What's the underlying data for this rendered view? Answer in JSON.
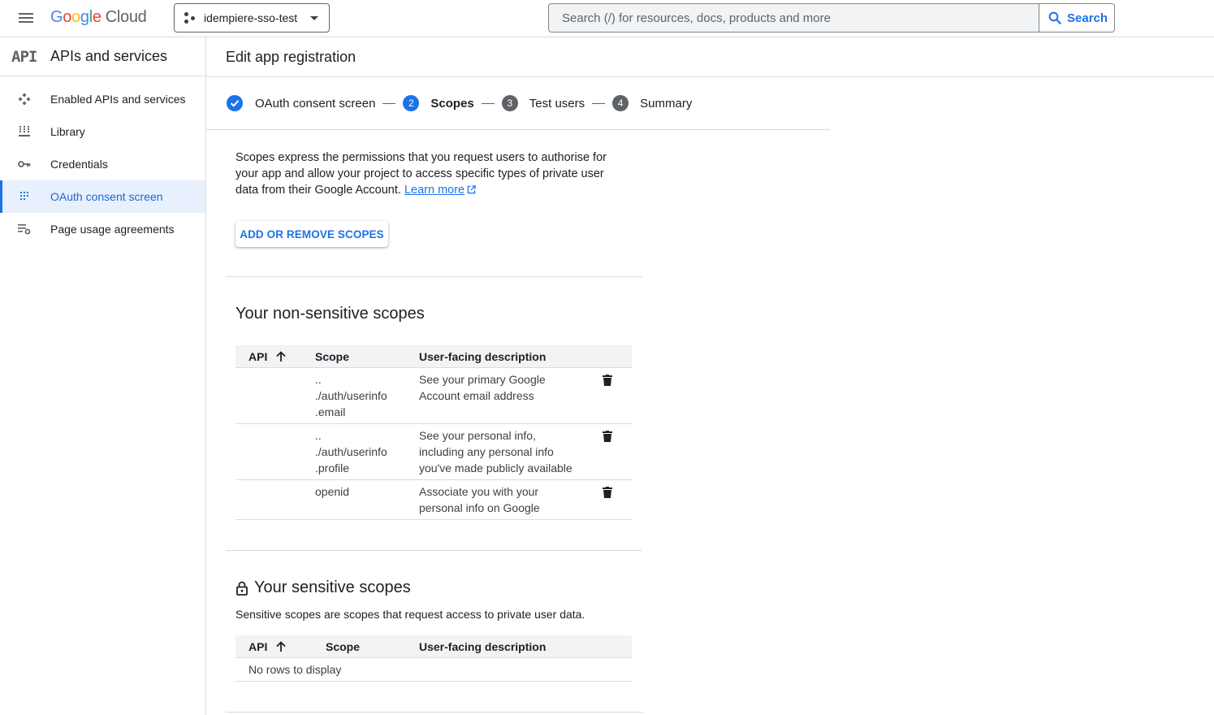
{
  "topbar": {
    "logo_google": "Google",
    "logo_cloud": "Cloud",
    "project_name": "idempiere-sso-test",
    "search_placeholder": "Search (/) for resources, docs, products and more",
    "search_button": "Search"
  },
  "sidebar": {
    "title": "APIs and services",
    "logo_text": "API",
    "items": [
      {
        "label": "Enabled APIs and services",
        "icon": "enabled-apis-icon"
      },
      {
        "label": "Library",
        "icon": "library-icon"
      },
      {
        "label": "Credentials",
        "icon": "key-icon"
      },
      {
        "label": "OAuth consent screen",
        "icon": "consent-icon",
        "active": true
      },
      {
        "label": "Page usage agreements",
        "icon": "agreements-icon"
      }
    ]
  },
  "main": {
    "title": "Edit app registration",
    "steps": [
      {
        "label": "OAuth consent screen",
        "state": "done"
      },
      {
        "number": "2",
        "label": "Scopes",
        "state": "current"
      },
      {
        "number": "3",
        "label": "Test users",
        "state": "pending"
      },
      {
        "number": "4",
        "label": "Summary",
        "state": "pending"
      }
    ],
    "intro": "Scopes express the permissions that you request users to authorise for your app and allow your project to access specific types of private user data from their Google Account.",
    "learn_more": "Learn more",
    "add_remove_button": "ADD OR REMOVE SCOPES",
    "non_sensitive": {
      "title": "Your non-sensitive scopes",
      "columns": {
        "api": "API",
        "scope": "Scope",
        "description": "User-facing description"
      },
      "rows": [
        {
          "api": "",
          "scope_lines": [
            "..",
            "./auth/userinfo",
            ".email"
          ],
          "description_lines": [
            "See your primary Google",
            "Account email address"
          ]
        },
        {
          "api": "",
          "scope_lines": [
            "..",
            "./auth/userinfo",
            ".profile"
          ],
          "description_lines": [
            "See your personal info,",
            "including any personal info",
            "you've made publicly available"
          ]
        },
        {
          "api": "",
          "scope_lines": [
            "openid"
          ],
          "description_lines": [
            "Associate you with your",
            "personal info on Google"
          ]
        }
      ]
    },
    "sensitive": {
      "title": "Your sensitive scopes",
      "description": "Sensitive scopes are scopes that request access to private user data.",
      "columns": {
        "api": "API",
        "scope": "Scope",
        "description": "User-facing description"
      },
      "empty_text": "No rows to display"
    }
  },
  "colors": {
    "accent": "#1a73e8",
    "active_bg": "#e8f0fe",
    "border": "#dadce0",
    "header_bg": "#f1f3f4"
  }
}
